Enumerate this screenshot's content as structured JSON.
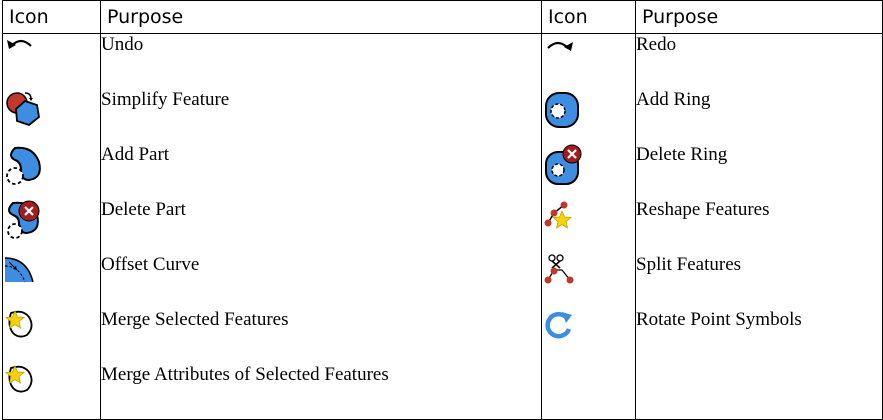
{
  "headers": {
    "icon": "Icon",
    "purpose": "Purpose",
    "icon2": "Icon",
    "purpose2": "Purpose"
  },
  "rows": [
    {
      "left": {
        "icon": "undo-icon",
        "label": "Undo"
      },
      "right": {
        "icon": "redo-icon",
        "label": "Redo"
      }
    },
    {
      "left": {
        "icon": "simplify-feature-icon",
        "label": "Simplify Feature"
      },
      "right": {
        "icon": "add-ring-icon",
        "label": "Add Ring"
      }
    },
    {
      "left": {
        "icon": "add-part-icon",
        "label": "Add Part"
      },
      "right": {
        "icon": "delete-ring-icon",
        "label": "Delete Ring"
      }
    },
    {
      "left": {
        "icon": "delete-part-icon",
        "label": "Delete Part"
      },
      "right": {
        "icon": "reshape-features-icon",
        "label": "Reshape Features"
      }
    },
    {
      "left": {
        "icon": "offset-curve-icon",
        "label": "Offset Curve"
      },
      "right": {
        "icon": "split-features-icon",
        "label": "Split Features"
      }
    },
    {
      "left": {
        "icon": "merge-selected-features-icon",
        "label": "Merge Selected Features"
      },
      "right": {
        "icon": "rotate-point-symbols-icon",
        "label": "Rotate Point Symbols"
      }
    },
    {
      "left": {
        "icon": "merge-attributes-icon",
        "label": "Merge Attributes of Selected Features"
      },
      "right": {
        "icon": "",
        "label": ""
      }
    }
  ],
  "colors": {
    "blue": "#3d8ee0",
    "red": "#c0392b",
    "star": "#f5d20a",
    "outline": "#000000"
  }
}
